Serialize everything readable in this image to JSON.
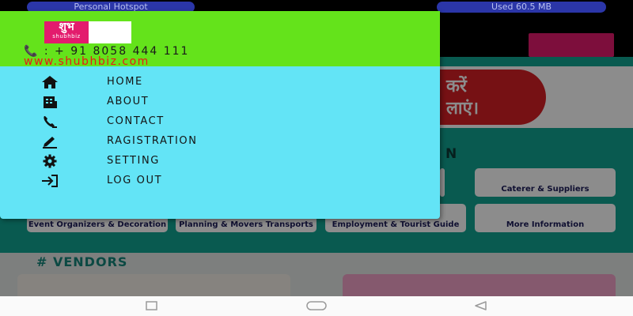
{
  "status_bar": {
    "left_pill": "Personal Hotspot",
    "right_pill": "Used 60.5 MB"
  },
  "drawer": {
    "logo_glyph": "शुभ",
    "logo_brand": "shubhbiz",
    "phone": "📞 : + 91 8058 444 111",
    "website": "www.shubhbiz.com",
    "menu": [
      {
        "label": "HOME",
        "icon": "home-icon"
      },
      {
        "label": "ABOUT",
        "icon": "building-icon"
      },
      {
        "label": "CONTACT",
        "icon": "phone-icon"
      },
      {
        "label": "RAGISTRATION",
        "icon": "pen-icon"
      },
      {
        "label": "SETTING",
        "icon": "gear-icon"
      },
      {
        "label": "LOG OUT",
        "icon": "logout-icon"
      }
    ]
  },
  "background": {
    "banner_text_line1": "करें",
    "banner_text_line2": "लाएं।",
    "section_partial": "N",
    "tiles": [
      {
        "caption": "Caterer & Suppliers"
      },
      {
        "caption": "Event Organizers & Decoration"
      },
      {
        "caption": "Planning & Movers Transports"
      },
      {
        "caption": "Employment & Tourist Guide"
      },
      {
        "caption": "More Information"
      }
    ],
    "vendors_title": "# VENDORS"
  },
  "colors": {
    "drawer_header": "#64e31b",
    "drawer_body": "#63e4f6",
    "website_text": "#e81818",
    "brand_pink": "#e31b6d"
  }
}
